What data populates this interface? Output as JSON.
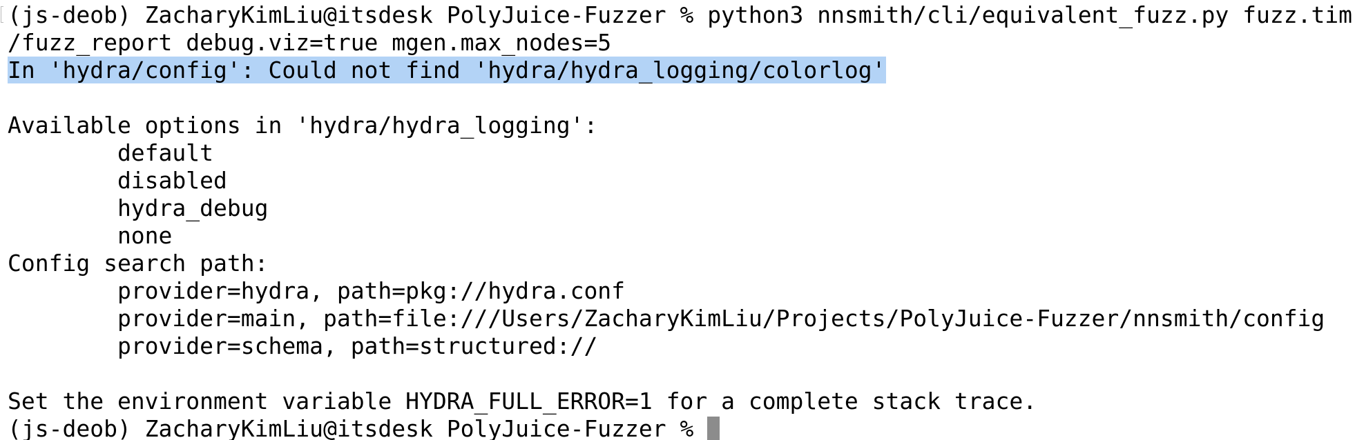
{
  "terminal": {
    "prompt": "(js-deob) ZacharyKimLiu@itsdesk PolyJuice-Fuzzer % ",
    "command_start": "python3 nnsmith/cli/equivalent_fuzz.py fuzz.tim",
    "command_wrap": "/fuzz_report debug.viz=true mgen.max_nodes=5",
    "error_line": "In 'hydra/config': Could not find 'hydra/hydra_logging/colorlog'",
    "options_header": "Available options in 'hydra/hydra_logging':",
    "options": [
      "        default",
      "        disabled",
      "        hydra_debug",
      "        none"
    ],
    "search_path_header": "Config search path:",
    "search_paths": [
      "        provider=hydra, path=pkg://hydra.conf",
      "        provider=main, path=file:///Users/ZacharyKimLiu/Projects/PolyJuice-Fuzzer/nnsmith/config",
      "        provider=schema, path=structured://"
    ],
    "hint": "Set the environment variable HYDRA_FULL_ERROR=1 for a complete stack trace.",
    "final_prompt": "(js-deob) ZacharyKimLiu@itsdesk PolyJuice-Fuzzer % "
  },
  "colors": {
    "background": "#ffffff",
    "text": "#000000",
    "selection": "#b3d3f6",
    "cursor": "#8c8c8c"
  }
}
